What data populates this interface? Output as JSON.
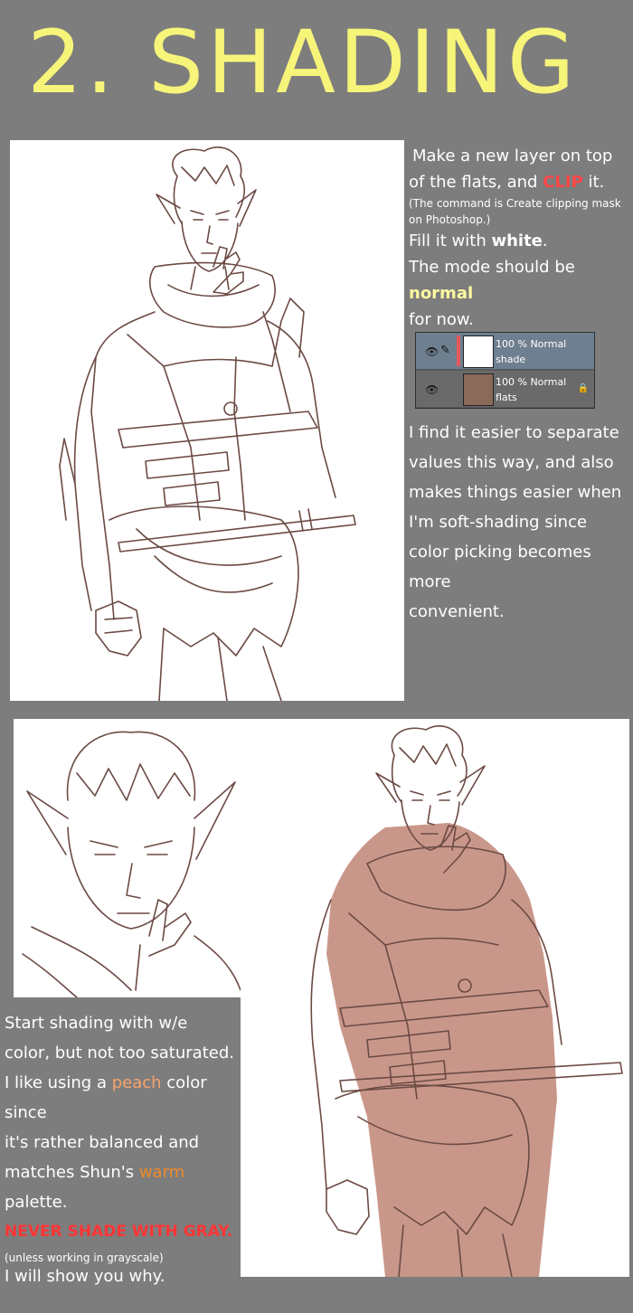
{
  "title": "2. SHADING",
  "intro": {
    "line1": "Make a new layer on top",
    "line2_pre": "of the flats, and ",
    "line2_clip": "CLIP",
    "line2_post": " it.",
    "note1": "(The command is Create clipping mask",
    "note2": "on Photoshop.)",
    "fill_pre": "Fill it with ",
    "fill_white": "white",
    "fill_post": ".",
    "mode_pre": "The mode should be ",
    "mode_normal": "normal",
    "mode_post": "for now."
  },
  "layers_panel": {
    "layers": [
      {
        "opacity_mode": "100 % Normal",
        "name": "shade",
        "icon_eye": "eye-icon",
        "icon_brush": "brush-icon"
      },
      {
        "opacity_mode": "100 % Normal",
        "name": "flats",
        "icon_eye": "eye-icon",
        "icon_lock": "lock-icon"
      }
    ]
  },
  "para2": [
    "I find it easier to separate",
    "values this way, and also",
    "makes things easier when",
    "I'm soft-shading since",
    "color picking becomes more",
    "convenient."
  ],
  "para3": {
    "l1": "Start shading with w/e",
    "l2": "color, but not too saturated.",
    "l3_pre": "I like using a ",
    "l3_peach": "peach",
    "l3_post": " color since",
    "l4": "it's rather balanced and",
    "l5_pre": "matches Shun's ",
    "l5_warm": "warm",
    "l6": "palette."
  },
  "warning": {
    "never": "NEVER SHADE WITH GRAY.",
    "paren": "(unless working in grayscale)",
    "show": "I will show you why."
  },
  "colors": {
    "background": "#7d7d7d",
    "title": "#f7f47a",
    "clip_red": "#ff4747",
    "normal_yellow": "#fffaa0",
    "peach": "#f7a46b",
    "warm": "#f08a2a",
    "line_art": "#6b4a44",
    "shade_fill": "#c9978a"
  }
}
